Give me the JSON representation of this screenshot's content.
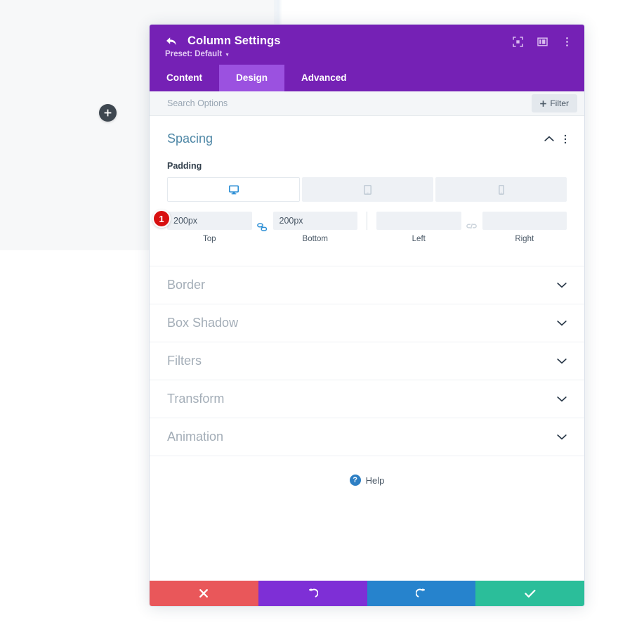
{
  "background": {
    "add_button_icon": "plus-icon"
  },
  "modal": {
    "header": {
      "back_icon": "back-arrow-icon",
      "title": "Column Settings",
      "preset_label": "Preset: Default",
      "icons": [
        {
          "name": "focus-expand-icon"
        },
        {
          "name": "split-layout-icon"
        },
        {
          "name": "more-vertical-icon"
        }
      ]
    },
    "tabs": [
      {
        "label": "Content",
        "active": false
      },
      {
        "label": "Design",
        "active": true
      },
      {
        "label": "Advanced",
        "active": false
      }
    ],
    "search": {
      "placeholder": "Search Options",
      "value": "",
      "filter_label": "Filter",
      "filter_icon": "plus-icon"
    },
    "spacing_section": {
      "title": "Spacing",
      "collapse_icon": "chevron-up-icon",
      "menu_icon": "more-vertical-icon",
      "padding": {
        "label": "Padding",
        "devices": [
          {
            "name": "desktop",
            "icon": "desktop-icon",
            "active": true
          },
          {
            "name": "tablet",
            "icon": "tablet-icon",
            "active": false
          },
          {
            "name": "phone",
            "icon": "phone-icon",
            "active": false
          }
        ],
        "badge": "1",
        "link_vertical_icon": "link-connected-icon",
        "link_horizontal_icon": "link-broken-icon",
        "fields": [
          {
            "key": "top",
            "value": "200px",
            "label": "Top"
          },
          {
            "key": "bottom",
            "value": "200px",
            "label": "Bottom"
          },
          {
            "key": "left",
            "value": "",
            "label": "Left"
          },
          {
            "key": "right",
            "value": "",
            "label": "Right"
          }
        ]
      }
    },
    "collapsed_sections": [
      {
        "title": "Border",
        "icon": "chevron-down-icon"
      },
      {
        "title": "Box Shadow",
        "icon": "chevron-down-icon"
      },
      {
        "title": "Filters",
        "icon": "chevron-down-icon"
      },
      {
        "title": "Transform",
        "icon": "chevron-down-icon"
      },
      {
        "title": "Animation",
        "icon": "chevron-down-icon"
      }
    ],
    "help": {
      "label": "Help",
      "icon": "question-mark-icon"
    },
    "footer": [
      {
        "name": "cancel",
        "icon": "close-x-icon",
        "color": "#e9575a"
      },
      {
        "name": "undo",
        "icon": "undo-arrow-icon",
        "color": "#7e2fd6"
      },
      {
        "name": "redo",
        "icon": "redo-arrow-icon",
        "color": "#2683cd"
      },
      {
        "name": "save",
        "icon": "check-icon",
        "color": "#2bbe9a"
      }
    ]
  },
  "colors": {
    "header_purple": "#7521b5",
    "tab_active_purple": "#9b51e0",
    "accent_blue": "#2d8fd5",
    "section_title": "#4e87a6",
    "badge_red": "#d81010"
  }
}
